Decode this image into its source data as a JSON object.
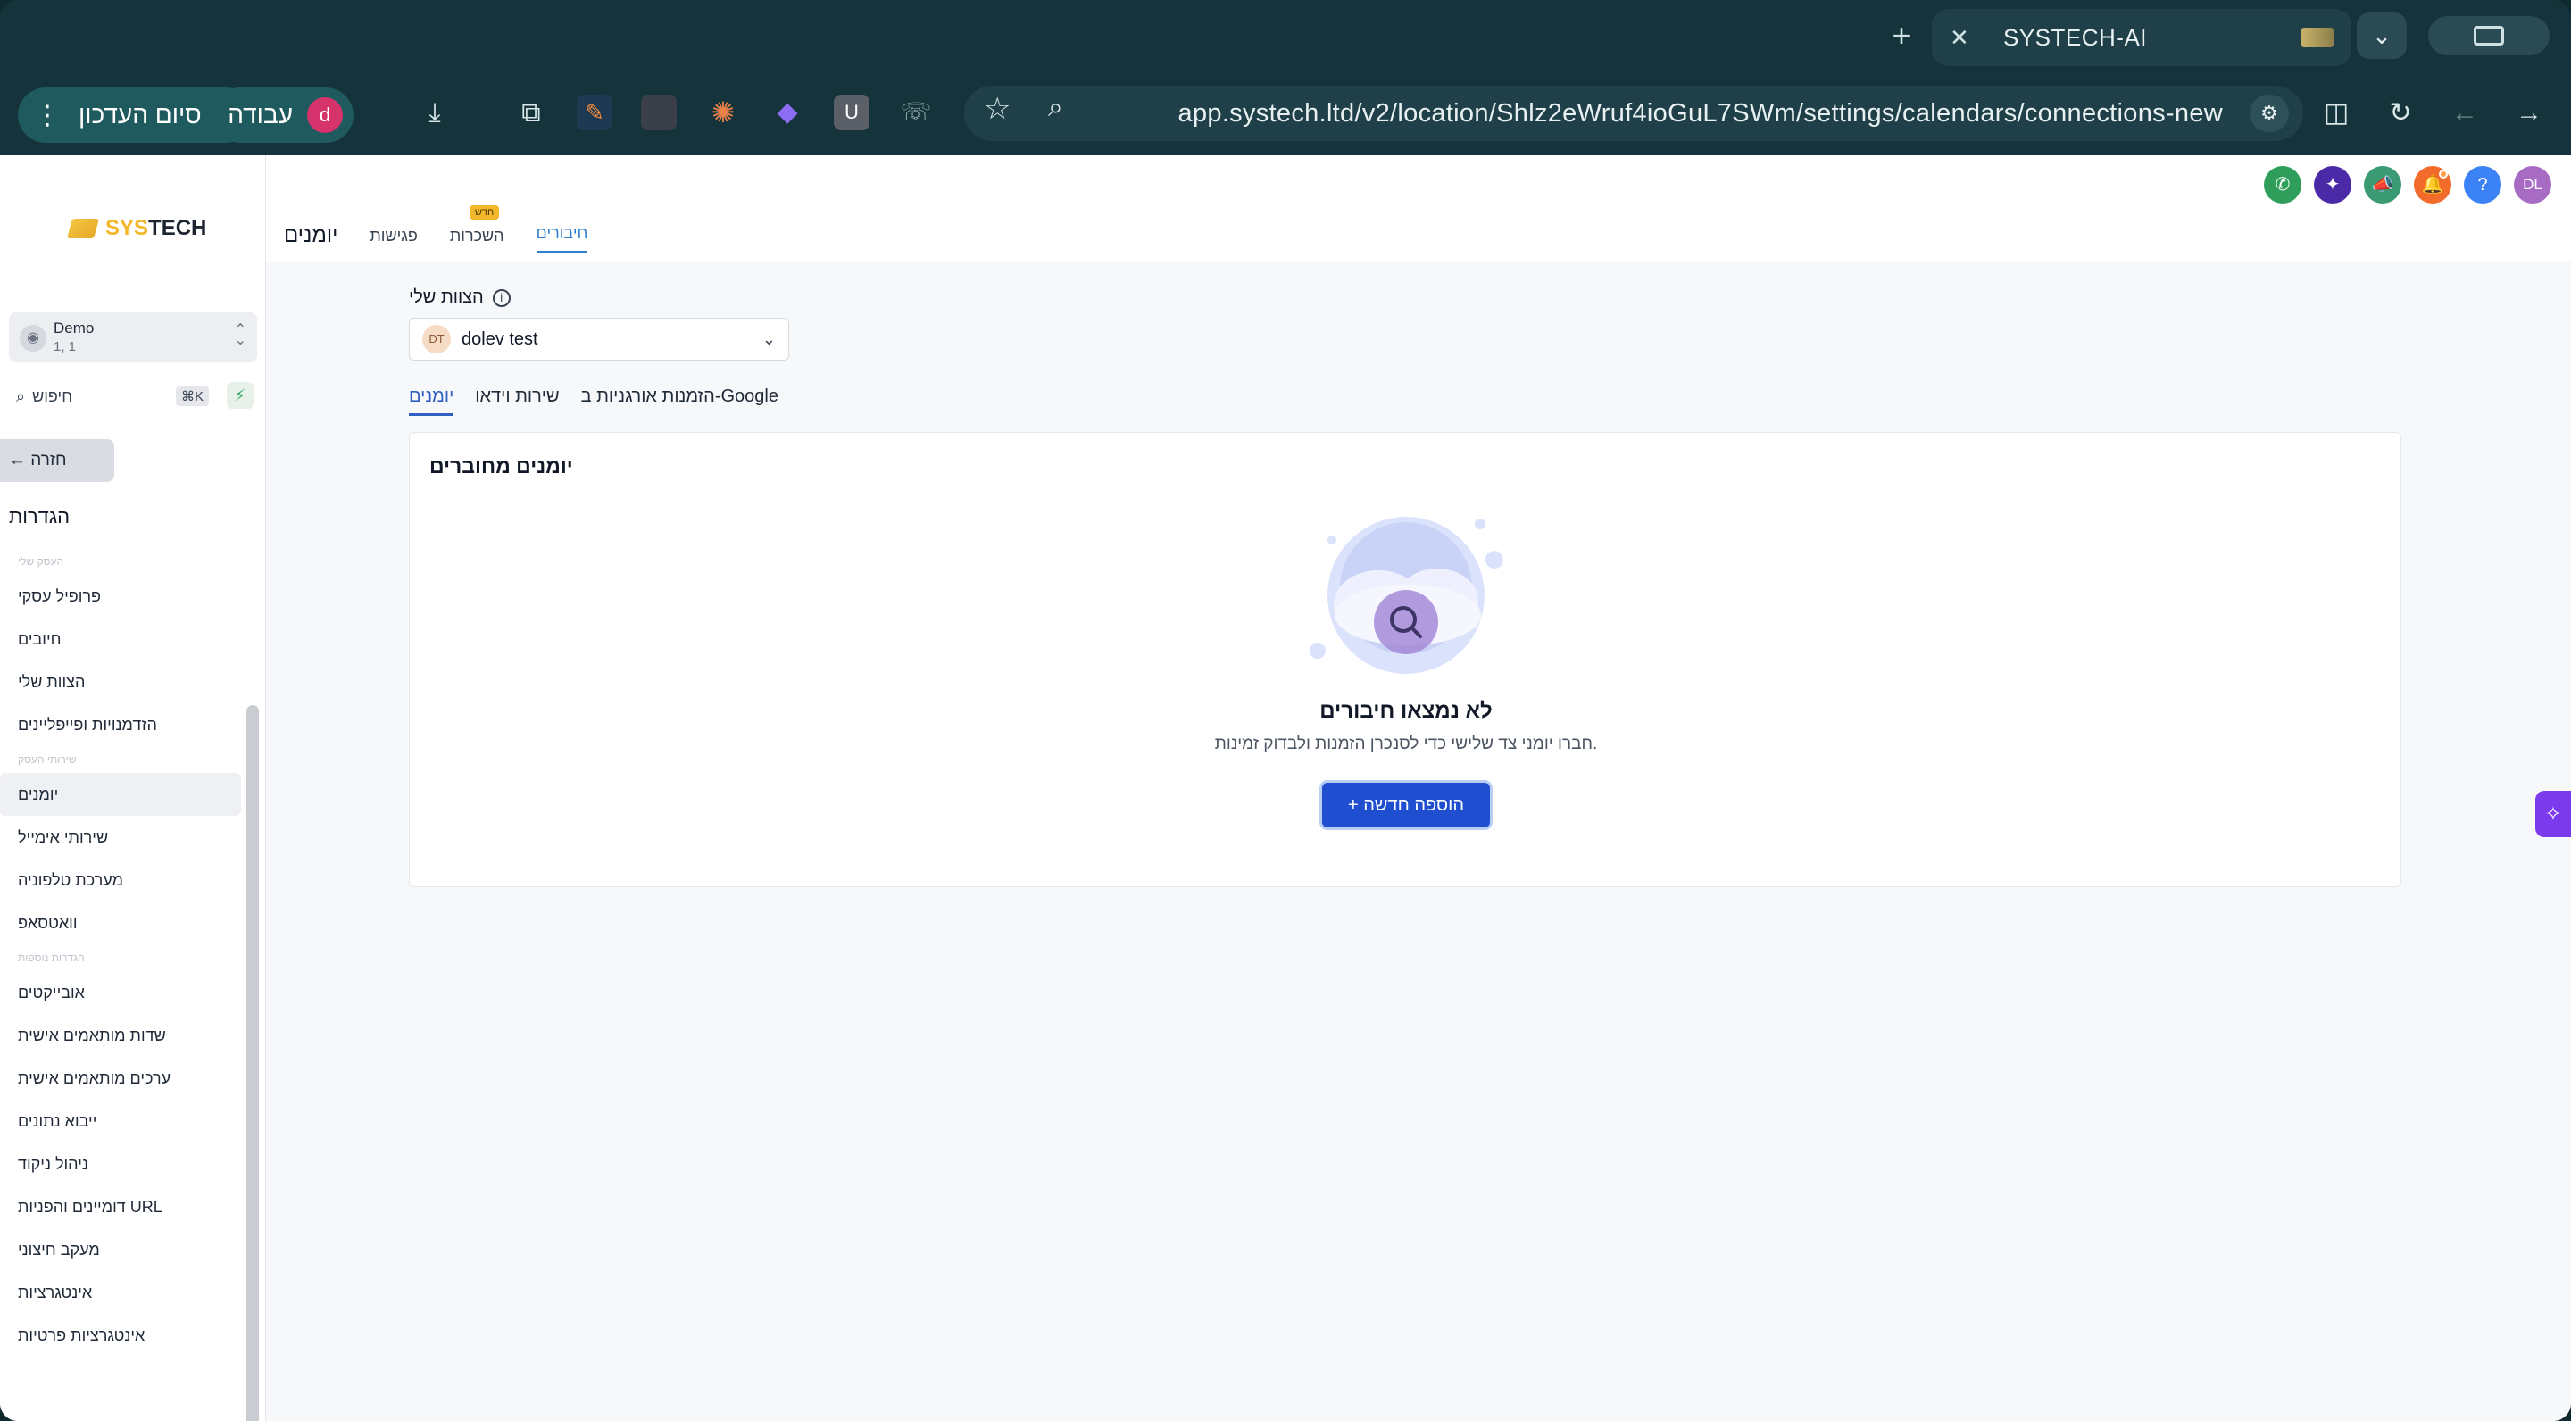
{
  "browser": {
    "tab_title": "SYSTECH-AI",
    "url": "app.systech.ltd/v2/location/Shlz2eWruf4ioGuL7SWm/settings/calendars/connections-new",
    "update_button": "סיום העדכון",
    "profile_label": "עבודה",
    "profile_initial": "d"
  },
  "sidebar": {
    "logo_sys": "SYS",
    "logo_tech": "TECH",
    "account_name": "Demo",
    "account_sub": "1, 1",
    "search_placeholder": "חיפוש",
    "search_shortcut": "⌘K",
    "back_label": "חזרה",
    "settings_title": "הגדרות",
    "sections": [
      {
        "heading": "העסק שלי",
        "items": [
          "פרופיל עסקי",
          "חיובים",
          "הצוות שלי",
          "הזדמנויות ופייפליינים"
        ]
      },
      {
        "heading": "שירותי העסק",
        "items": [
          "יומנים",
          "שירותי אימייל",
          "מערכת טלפוניה",
          "וואטסאפ"
        ]
      },
      {
        "heading": "הגדרות נוספות",
        "items": [
          "אובייקטים",
          "שדות מותאמים אישית",
          "ערכים מותאמים אישית",
          "ייבוא נתונים",
          "ניהול ניקוד",
          "דומיינים והפניות URL",
          "מעקב חיצוני",
          "אינטגרציות",
          "אינטגרציות פרטיות"
        ]
      }
    ],
    "active_item": "יומנים"
  },
  "header": {
    "page_title": "יומנים",
    "tabs": [
      {
        "label": "פגישות"
      },
      {
        "label": "השכרות",
        "badge": "חדש"
      },
      {
        "label": "חיבורים",
        "active": true
      }
    ],
    "user_initials": "DL"
  },
  "main": {
    "team_label": "הצוות שלי",
    "team_value": "dolev test",
    "team_initials": "DT",
    "subtabs": [
      "יומנים",
      "שירות וידאו",
      "הזמנות אורגניות ב-Google"
    ],
    "active_subtab": "יומנים",
    "card_title": "יומנים מחוברים",
    "empty_title": "לא נמצאו חיבורים",
    "empty_subtitle": "חברו יומני צד שלישי כדי לסנכרן הזמנות ולבדוק זמינות.",
    "add_button": "+ הוספה חדשה"
  },
  "colors": {
    "accent": "#1f4ed1",
    "active_tab": "#2f7fd0",
    "brand_yellow": "#f2b72a"
  }
}
